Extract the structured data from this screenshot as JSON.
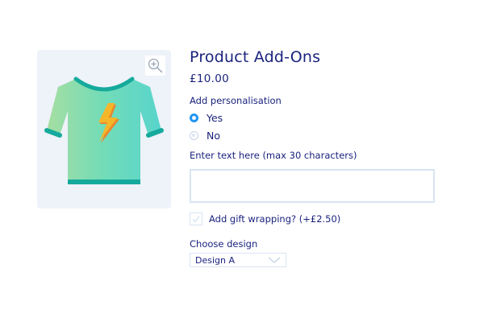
{
  "product": {
    "title": "Product Add-Ons",
    "price": "£10.00"
  },
  "image": {
    "zoom_icon": "zoom-in-icon",
    "graphic": "t-shirt with lightning bolt"
  },
  "personalisation": {
    "label": "Add personalisation",
    "options": [
      {
        "label": "Yes",
        "checked": true
      },
      {
        "label": "No",
        "checked": false
      }
    ]
  },
  "text_entry": {
    "label": "Enter text here (max 30 characters)",
    "value": "",
    "placeholder": ""
  },
  "gift_wrap": {
    "label": "Add gift wrapping? (+£2.50)",
    "checked": false
  },
  "design": {
    "label": "Choose design",
    "selected": "Design A",
    "icon": "chevron-down-icon"
  },
  "colors": {
    "text": "#1a237e",
    "accent": "#2196f3",
    "border": "#d8e4f2",
    "image_bg": "#eef2f9",
    "shirt_teal": "#5ed6c9",
    "shirt_trim": "#16aa9c",
    "bolt": "#f5b62a"
  }
}
